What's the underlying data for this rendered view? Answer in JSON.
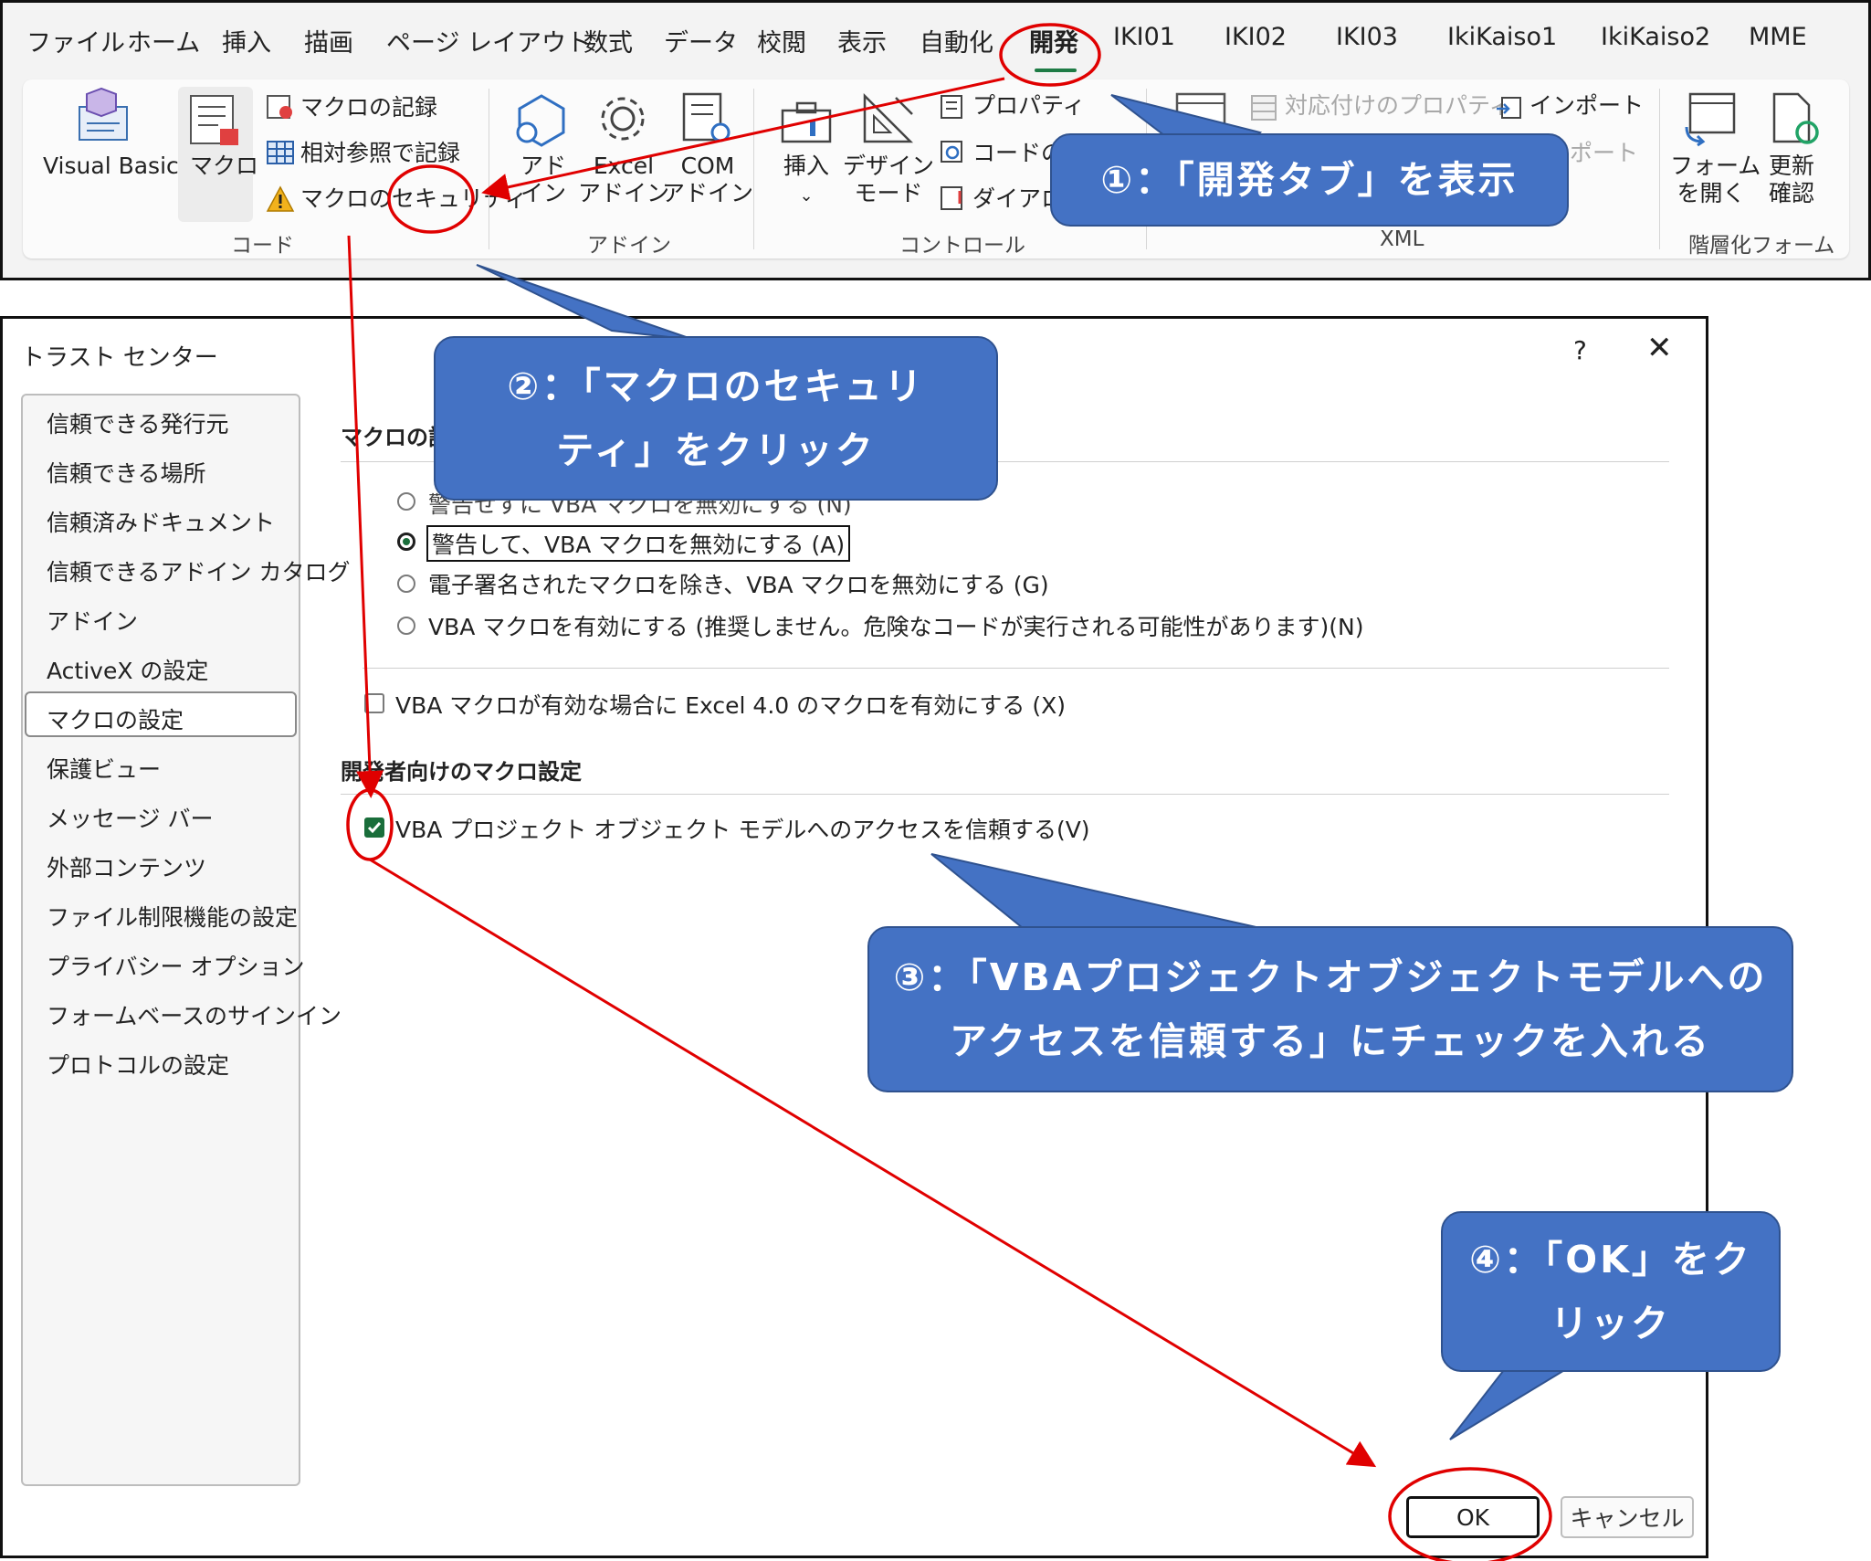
{
  "ribbon": {
    "tabs": [
      "ファイル",
      "ホーム",
      "挿入",
      "描画",
      "ページ レイアウト",
      "数式",
      "データ",
      "校閲",
      "表示",
      "自動化",
      "開発",
      "IKI01",
      "IKI02",
      "IKI03",
      "IkiKaiso1",
      "IkiKaiso2",
      "MME"
    ],
    "active_tab": "開発",
    "code_group": {
      "visual_basic": "Visual Basic",
      "macro": "マクロ",
      "record_macro": "マクロの記録",
      "relative_ref": "相対参照で記録",
      "macro_security": "マクロのセキュリティ",
      "label": "コード"
    },
    "addin_group": {
      "addin_top": "アド",
      "addin_bottom": "イン",
      "excel_addin_top": "Excel",
      "excel_addin_bottom": "アドイン",
      "com_addin_top": "COM",
      "com_addin_bottom": "アドイン",
      "label": "アドイン"
    },
    "controls_group": {
      "insert": "挿入",
      "design_top": "デザイン",
      "design_bottom": "モード",
      "properties": "プロパティ",
      "view_code": "コードの表",
      "dialog": "ダイアログ",
      "label": "コントロール"
    },
    "xml_group": {
      "map_props": "対応付けのプロパティ",
      "import": "インポート",
      "export": "ポート",
      "label": "XML"
    },
    "form_group": {
      "open_form_top": "フォーム",
      "open_form_bottom": "を開く",
      "refresh_top": "更新",
      "refresh_bottom": "確認",
      "label": "階層化フォーム"
    }
  },
  "dialog": {
    "title": "トラスト センター",
    "help": "?",
    "close": "✕",
    "nav": [
      "信頼できる発行元",
      "信頼できる場所",
      "信頼済みドキュメント",
      "信頼できるアドイン カタログ",
      "アドイン",
      "ActiveX の設定",
      "マクロの設定",
      "保護ビュー",
      "メッセージ バー",
      "外部コンテンツ",
      "ファイル制限機能の設定",
      "プライバシー オプション",
      "フォームベースのサインイン",
      "プロトコルの設定"
    ],
    "selected_nav": "マクロの設定",
    "macro_section_title": "マクロの設",
    "radios": [
      {
        "label": "警告せずに VBA マクロを無効にする (N)",
        "selected": false
      },
      {
        "label": "警告して、VBA マクロを無効にする (A)",
        "selected": true
      },
      {
        "label": "電子署名されたマクロを除き、VBA マクロを無効にする (G)",
        "selected": false
      },
      {
        "label": "VBA マクロを有効にする (推奨しません。危険なコードが実行される可能性があります)(N)",
        "selected": false
      }
    ],
    "excel4_checkbox": "VBA マクロが有効な場合に Excel 4.0 のマクロを有効にする (X)",
    "dev_section_title": "開発者向けのマクロ設定",
    "vba_trust_checkbox": "VBA プロジェクト オブジェクト モデルへのアクセスを信頼する(V)",
    "vba_trust_checked": true,
    "ok": "OK",
    "cancel": "キャンセル"
  },
  "callouts": {
    "step1": "①：「開発タブ」を表示",
    "step2_line1": "②：「マクロのセキュリ",
    "step2_line2": "ティ」をクリック",
    "step3_line1": "③：「VBAプロジェクトオブジェクトモデルへの",
    "step3_line2": "アクセスを信頼する」にチェックを入れる",
    "step4_line1": "④：「OK」をク",
    "step4_line2": "リック"
  },
  "colors": {
    "callout_fill": "#4472c4",
    "annotation_red": "#e00000",
    "excel_green": "#1a6e3b"
  }
}
